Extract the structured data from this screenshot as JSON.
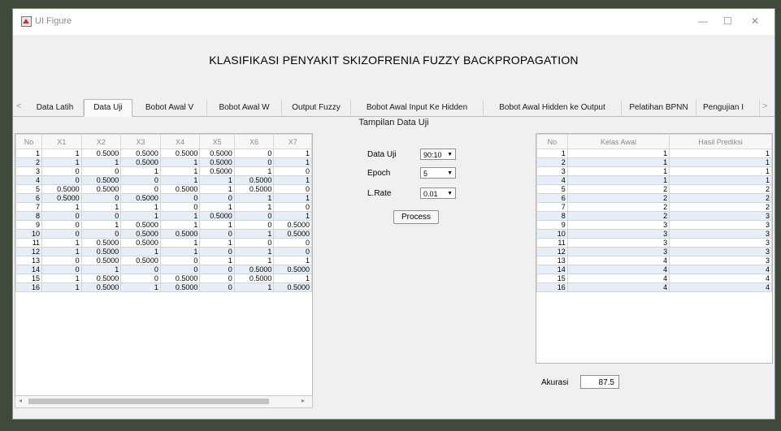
{
  "window": {
    "title": "UI Figure",
    "minimize": "—",
    "maximize": "☐",
    "close": "✕"
  },
  "heading": "KLASIFIKASI PENYAKIT SKIZOFRENIA FUZZY BACKPROPAGATION",
  "tabs": [
    {
      "label": "Data Latih",
      "active": false
    },
    {
      "label": "Data Uji",
      "active": true
    },
    {
      "label": "Bobot Awal V",
      "active": false
    },
    {
      "label": "Bobot Awal W",
      "active": false
    },
    {
      "label": "Output Fuzzy",
      "active": false
    },
    {
      "label": "Bobot Awal Input Ke Hidden",
      "active": false
    },
    {
      "label": "Bobot Awal Hidden ke Output",
      "active": false
    },
    {
      "label": "Pelatihan BPNN",
      "active": false
    },
    {
      "label": "Pengujian I",
      "active": false
    }
  ],
  "panel_title": "Tampilan Data Uji",
  "data_table": {
    "headers": [
      "No",
      "X1",
      "X2",
      "X3",
      "X4",
      "X5",
      "X6",
      "X7"
    ],
    "rows": [
      [
        "1",
        "1",
        "0.5000",
        "0.5000",
        "0.5000",
        "0.5000",
        "0",
        "1"
      ],
      [
        "2",
        "1",
        "1",
        "0.5000",
        "1",
        "0.5000",
        "0",
        "1"
      ],
      [
        "3",
        "0",
        "0",
        "1",
        "1",
        "0.5000",
        "1",
        "0"
      ],
      [
        "4",
        "0",
        "0.5000",
        "0",
        "1",
        "1",
        "0.5000",
        "1"
      ],
      [
        "5",
        "0.5000",
        "0.5000",
        "0",
        "0.5000",
        "1",
        "0.5000",
        "0"
      ],
      [
        "6",
        "0.5000",
        "0",
        "0.5000",
        "0",
        "0",
        "1",
        "1"
      ],
      [
        "7",
        "1",
        "1",
        "1",
        "0",
        "1",
        "1",
        "0"
      ],
      [
        "8",
        "0",
        "0",
        "1",
        "1",
        "0.5000",
        "0",
        "1"
      ],
      [
        "9",
        "0",
        "1",
        "0.5000",
        "1",
        "1",
        "0",
        "0.5000"
      ],
      [
        "10",
        "0",
        "0",
        "0.5000",
        "0.5000",
        "0",
        "1",
        "0.5000"
      ],
      [
        "11",
        "1",
        "0.5000",
        "0.5000",
        "1",
        "1",
        "0",
        "0"
      ],
      [
        "12",
        "1",
        "0.5000",
        "1",
        "1",
        "0",
        "1",
        "0"
      ],
      [
        "13",
        "0",
        "0.5000",
        "0.5000",
        "0",
        "1",
        "1",
        "1"
      ],
      [
        "14",
        "0",
        "1",
        "0",
        "0",
        "0",
        "0.5000",
        "0.5000"
      ],
      [
        "15",
        "1",
        "0.5000",
        "0",
        "0.5000",
        "0",
        "0.5000",
        "1"
      ],
      [
        "16",
        "1",
        "0.5000",
        "1",
        "0.5000",
        "0",
        "1",
        "0.5000"
      ]
    ]
  },
  "controls": {
    "data_uji": {
      "label": "Data Uji",
      "value": "90:10"
    },
    "epoch": {
      "label": "Epoch",
      "value": "5"
    },
    "lrate": {
      "label": "L.Rate",
      "value": "0.01"
    },
    "process_label": "Process"
  },
  "result_table": {
    "headers": [
      "No",
      "Kelas Awal",
      "Hasil Prediksi"
    ],
    "rows": [
      [
        "1",
        "1",
        "1"
      ],
      [
        "2",
        "1",
        "1"
      ],
      [
        "3",
        "1",
        "1"
      ],
      [
        "4",
        "1",
        "1"
      ],
      [
        "5",
        "2",
        "2"
      ],
      [
        "6",
        "2",
        "2"
      ],
      [
        "7",
        "2",
        "2"
      ],
      [
        "8",
        "2",
        "3"
      ],
      [
        "9",
        "3",
        "3"
      ],
      [
        "10",
        "3",
        "3"
      ],
      [
        "11",
        "3",
        "3"
      ],
      [
        "12",
        "3",
        "3"
      ],
      [
        "13",
        "4",
        "3"
      ],
      [
        "14",
        "4",
        "4"
      ],
      [
        "15",
        "4",
        "4"
      ],
      [
        "16",
        "4",
        "4"
      ]
    ]
  },
  "akurasi": {
    "label": "Akurasi",
    "value": "87.5"
  }
}
